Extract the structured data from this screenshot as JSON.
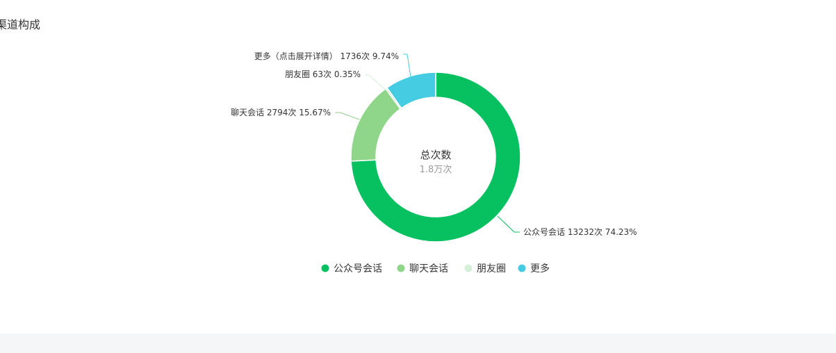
{
  "section_title": "渠道构成",
  "chart_data": {
    "type": "pie",
    "center": {
      "title": "总次数",
      "value": "1.8万次"
    },
    "slices": [
      {
        "name": "公众号会话",
        "label": "公众号会话 13232次 74.23%",
        "value": 13232,
        "percent": 74.23,
        "color": "#07c160"
      },
      {
        "name": "聊天会话",
        "label": "聊天会话 2794次 15.67%",
        "value": 2794,
        "percent": 15.67,
        "color": "#8fd68b"
      },
      {
        "name": "朋友圈",
        "label": "朋友圈 63次 0.35%",
        "value": 63,
        "percent": 0.35,
        "color": "#d5f0d6"
      },
      {
        "name": "更多",
        "label": "更多（点击展开详情） 1736次 9.74%",
        "value": 1736,
        "percent": 9.74,
        "color": "#45cce2"
      }
    ],
    "legend": [
      "公众号会话",
      "聊天会话",
      "朋友圈",
      "更多"
    ],
    "legend_position": "bottom"
  }
}
